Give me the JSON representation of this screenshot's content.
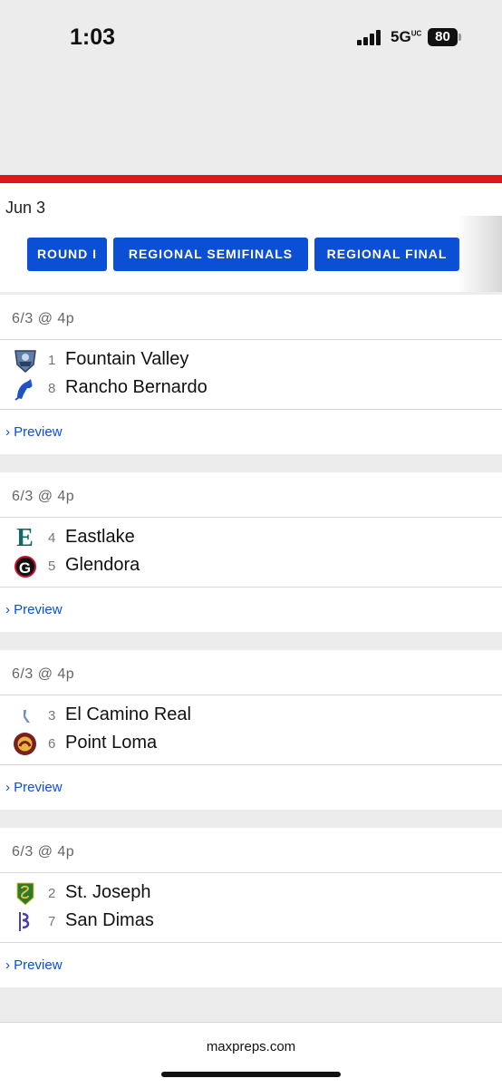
{
  "status": {
    "time": "1:03",
    "network": "5G",
    "network_sup": "UC",
    "battery": "80"
  },
  "date": "Jun 3",
  "tabs": [
    "ROUND I",
    "REGIONAL SEMIFINALS",
    "REGIONAL FINAL"
  ],
  "games": [
    {
      "when": "6/3 @ 4p",
      "preview": "Preview",
      "teams": [
        {
          "seed": "1",
          "name": "Fountain Valley",
          "logo": "fountain-valley-logo"
        },
        {
          "seed": "8",
          "name": "Rancho Bernardo",
          "logo": "rancho-bernardo-logo"
        }
      ]
    },
    {
      "when": "6/3 @ 4p",
      "preview": "Preview",
      "teams": [
        {
          "seed": "4",
          "name": "Eastlake",
          "logo": "eastlake-logo",
          "glyph": "E"
        },
        {
          "seed": "5",
          "name": "Glendora",
          "logo": "glendora-logo",
          "glyph": "G"
        }
      ]
    },
    {
      "when": "6/3 @ 4p",
      "preview": "Preview",
      "teams": [
        {
          "seed": "3",
          "name": "El Camino Real",
          "logo": "el-camino-real-logo"
        },
        {
          "seed": "6",
          "name": "Point Loma",
          "logo": "point-loma-logo"
        }
      ]
    },
    {
      "when": "6/3 @ 4p",
      "preview": "Preview",
      "teams": [
        {
          "seed": "2",
          "name": "St. Joseph",
          "logo": "st-joseph-logo"
        },
        {
          "seed": "7",
          "name": "San Dimas",
          "logo": "san-dimas-logo"
        }
      ]
    }
  ],
  "footer": "maxpreps.com",
  "colors": {
    "accent_blue": "#0a4fd6",
    "brand_red": "#e4141b",
    "eastlake_teal": "#0d6b63",
    "glendora_red": "#c8102e",
    "point_loma_maroon": "#7a1f1f",
    "point_loma_gold": "#e9b43a",
    "st_joseph_green": "#2c7a2c",
    "san_dimas_purple": "#4b3fb0"
  }
}
